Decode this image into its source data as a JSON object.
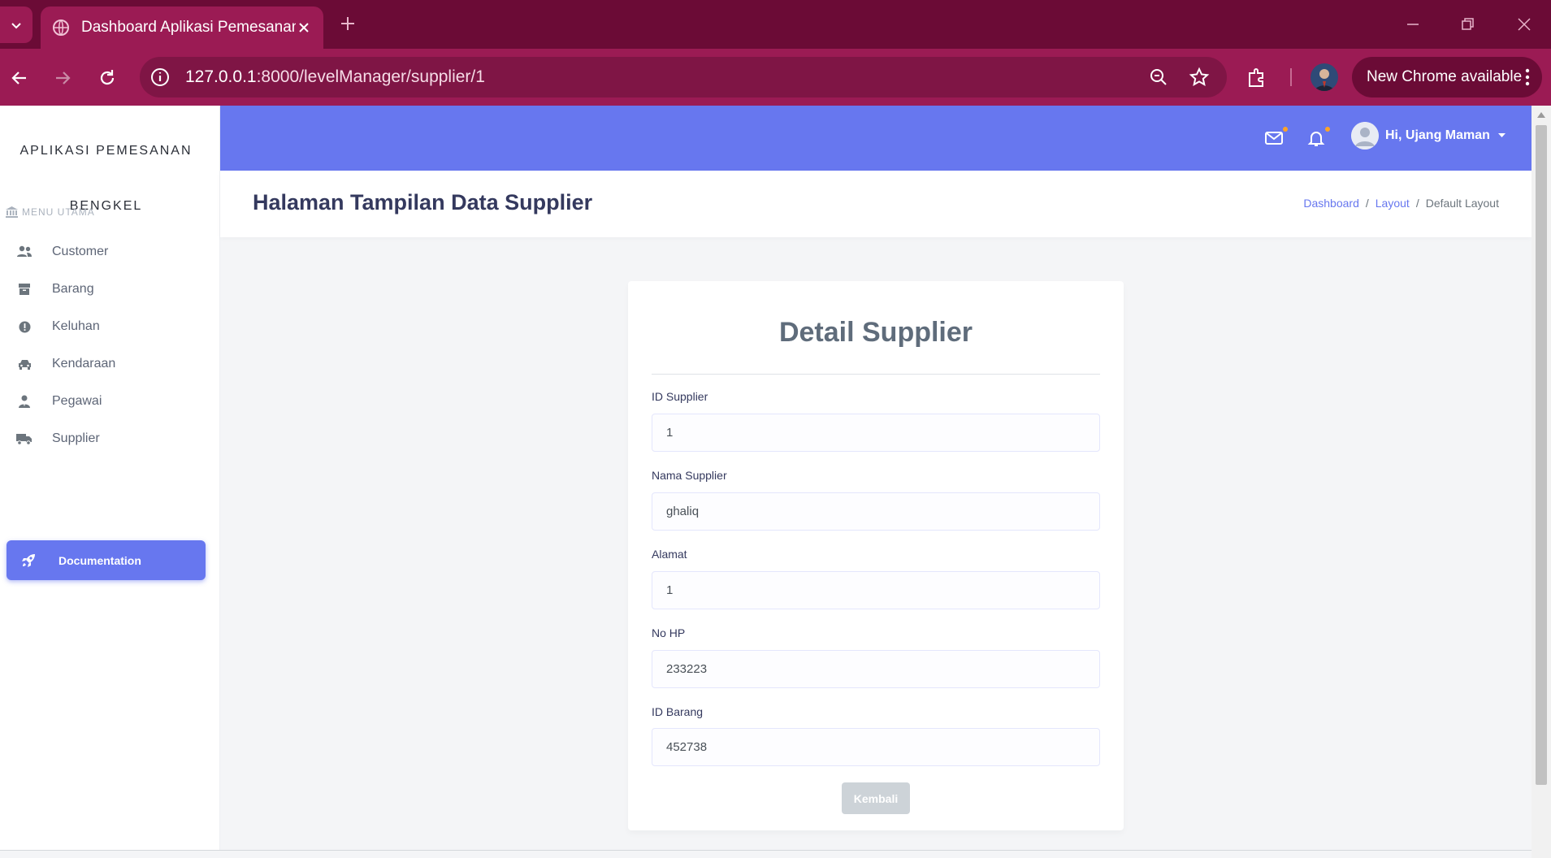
{
  "browser": {
    "tab_title": "Dashboard Aplikasi Pemesanan",
    "url_host": "127.0.0.1",
    "url_path": ":8000/levelManager/supplier/1",
    "update_label": "New Chrome available"
  },
  "sidebar": {
    "brand_line1": "APLIKASI PEMESANAN",
    "brand_line2": "BENGKEL",
    "menu_header": "MENU UTAMA",
    "items": [
      {
        "label": "Customer",
        "icon": "users-icon"
      },
      {
        "label": "Barang",
        "icon": "box-icon"
      },
      {
        "label": "Keluhan",
        "icon": "exclamation-icon"
      },
      {
        "label": "Kendaraan",
        "icon": "car-icon"
      },
      {
        "label": "Pegawai",
        "icon": "user-tie-icon"
      },
      {
        "label": "Supplier",
        "icon": "truck-icon"
      }
    ],
    "doc_label": "Documentation"
  },
  "topnav": {
    "user_greeting": "Hi, Ujang Maman"
  },
  "header": {
    "title": "Halaman Tampilan Data Supplier",
    "breadcrumb": [
      "Dashboard",
      "Layout",
      "Default Layout"
    ]
  },
  "card": {
    "title": "Detail Supplier",
    "fields": [
      {
        "label": "ID Supplier",
        "value": "1"
      },
      {
        "label": "Nama Supplier",
        "value": "ghaliq"
      },
      {
        "label": "Alamat",
        "value": "1"
      },
      {
        "label": "No HP",
        "value": "233223"
      },
      {
        "label": "ID Barang",
        "value": "452738"
      }
    ],
    "back_label": "Kembali"
  },
  "colors": {
    "primary": "#6777ef",
    "chrome_dark": "#6b0b36",
    "chrome_mid": "#9b1b54"
  }
}
